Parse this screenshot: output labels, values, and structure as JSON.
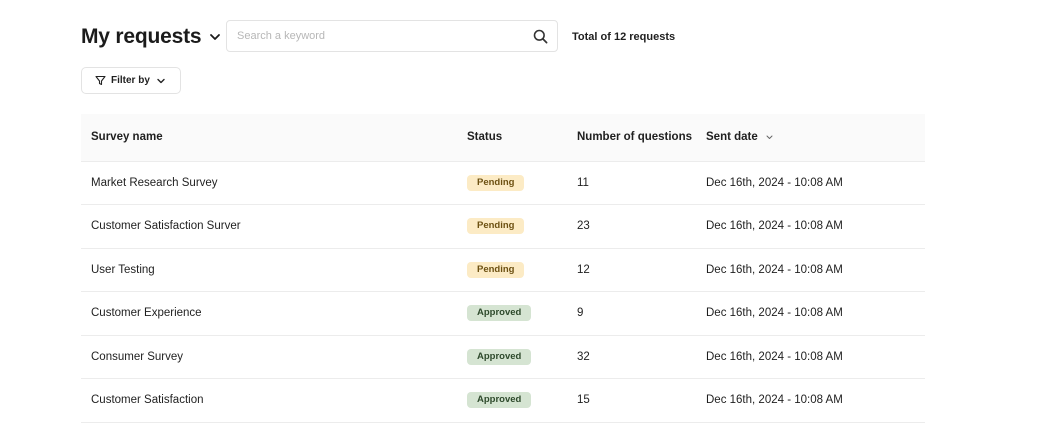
{
  "header": {
    "title": "My requests",
    "search_placeholder": "Search a keyword",
    "total": "Total of 12  requests"
  },
  "filter": {
    "label": "Filter by"
  },
  "table": {
    "columns": [
      "Survey name",
      "Status",
      "Number of questions",
      "Sent date"
    ],
    "rows": [
      {
        "name": "Market Research Survey",
        "status": "Pending",
        "status_type": "pending",
        "questions": "11",
        "sent": "Dec 16th, 2024 - 10:08 AM"
      },
      {
        "name": "Customer Satisfaction Surver",
        "status": "Pending",
        "status_type": "pending",
        "questions": "23",
        "sent": "Dec 16th, 2024 - 10:08 AM"
      },
      {
        "name": "User Testing",
        "status": "Pending",
        "status_type": "pending",
        "questions": "12",
        "sent": "Dec 16th, 2024 - 10:08 AM"
      },
      {
        "name": "Customer Experience",
        "status": "Approved",
        "status_type": "approved",
        "questions": "9",
        "sent": "Dec 16th, 2024 - 10:08 AM"
      },
      {
        "name": "Consumer Survey",
        "status": "Approved",
        "status_type": "approved",
        "questions": "32",
        "sent": "Dec 16th, 2024 - 10:08 AM"
      },
      {
        "name": "Customer Satisfaction",
        "status": "Approved",
        "status_type": "approved",
        "questions": "15",
        "sent": "Dec 16th, 2024 - 10:08 AM"
      }
    ]
  },
  "colors": {
    "pending_bg": "#fcebc5",
    "approved_bg": "#d5e4d2",
    "header_row_bg": "#fafafa",
    "border": "#ececec"
  },
  "icons": {
    "title": "chevron-down-icon",
    "search": "search-icon",
    "filter": "filter-icon",
    "sort": "chevron-down-icon"
  }
}
